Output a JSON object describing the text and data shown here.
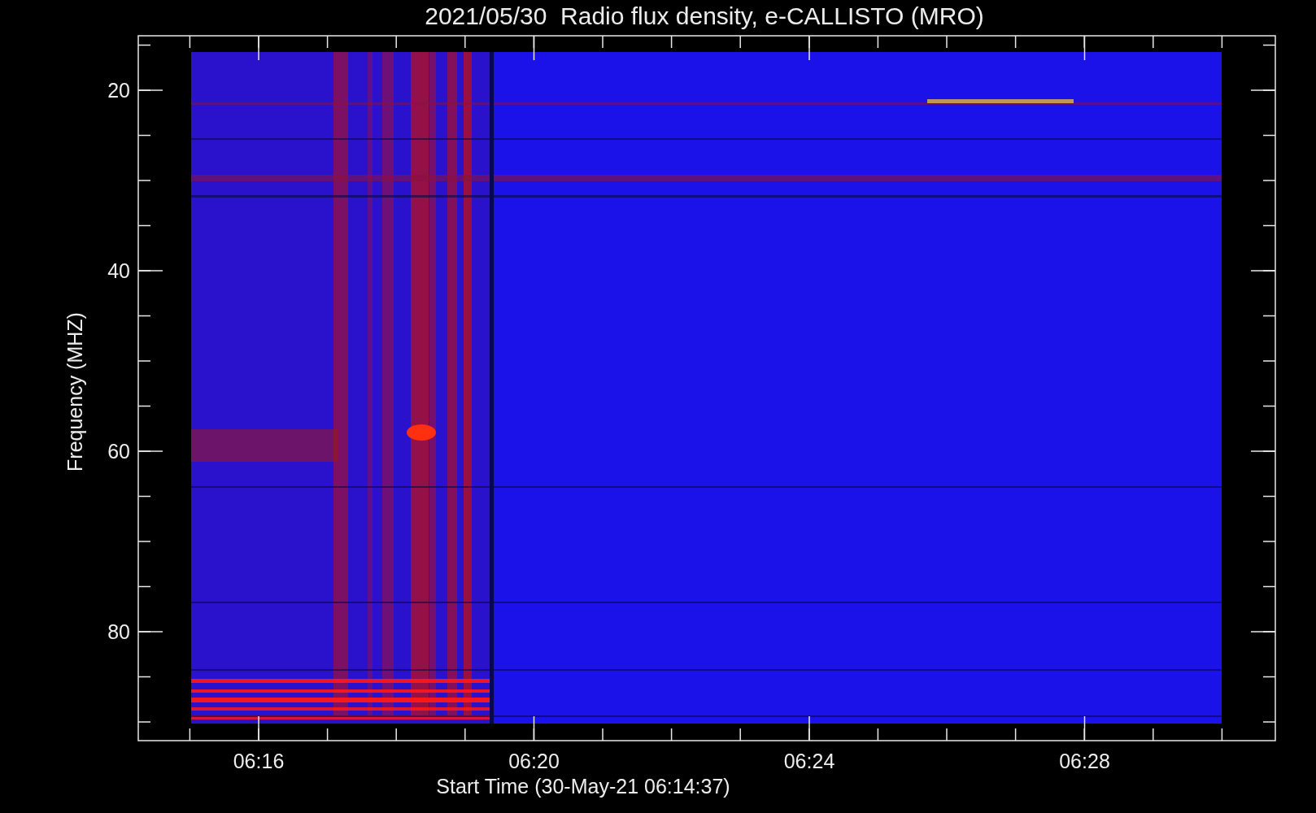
{
  "title": "2021/05/30  Radio flux density, e-CALLISTO (MRO)",
  "plot": {
    "ylabel": "Frequency (MHZ)",
    "xlabel": "Start Time (30-May-21 06:14:37)",
    "yticks": [
      "20",
      "40",
      "60",
      "80"
    ],
    "xticks": [
      "06:16",
      "06:20",
      "06:24",
      "06:28"
    ]
  }
}
